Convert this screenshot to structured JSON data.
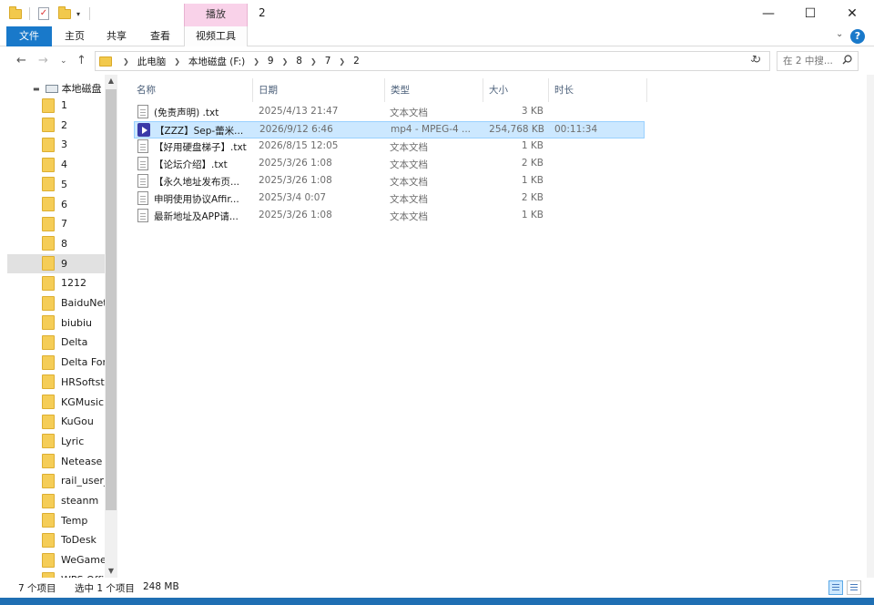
{
  "window": {
    "title": "2",
    "context_tab": "播放",
    "minimize": "—",
    "maximize": "☐",
    "close": "✕"
  },
  "ribbon": {
    "tabs": [
      "文件",
      "主页",
      "共享",
      "查看",
      "视频工具"
    ],
    "expand": "⌄",
    "help": "?"
  },
  "nav": {
    "back": "←",
    "forward": "→",
    "recent": "⌄",
    "up": "↑",
    "breadcrumb": [
      "此电脑",
      "本地磁盘 (F:)",
      "9",
      "8",
      "7",
      "2"
    ],
    "refresh": "↻",
    "search_placeholder": "在 2 中搜..."
  },
  "navpane": {
    "root": "本地磁盘 (F:)",
    "items": [
      "1",
      "2",
      "3",
      "4",
      "5",
      "6",
      "7",
      "8",
      "9",
      "1212",
      "BaiduNetdisk",
      "biubiu",
      "Delta",
      "Delta Force",
      "HRSoftstore",
      "KGMusic",
      "KuGou",
      "Lyric",
      "Netease",
      "rail_user_data",
      "steanm",
      "Temp",
      "ToDesk",
      "WeGameApps",
      "WPS Office"
    ],
    "selected_index": 8
  },
  "columns": [
    "名称",
    "日期",
    "类型",
    "大小",
    "时长"
  ],
  "files": [
    {
      "name": "(免责声明) .txt",
      "date": "2025/4/13 21:47",
      "type": "文本文档",
      "size": "3 KB",
      "duration": "",
      "icon": "text-file-icon",
      "selected": false
    },
    {
      "name": "【ZZZ】Sep-蕾米...",
      "date": "2026/9/12 6:46",
      "type": "mp4 - MPEG-4 ...",
      "size": "254,768 KB",
      "duration": "00:11:34",
      "icon": "video-file-icon",
      "selected": true
    },
    {
      "name": "【好用硬盘梯子】.txt",
      "date": "2026/8/15 12:05",
      "type": "文本文档",
      "size": "1 KB",
      "duration": "",
      "icon": "text-file-icon",
      "selected": false
    },
    {
      "name": "【论坛介绍】.txt",
      "date": "2025/3/26 1:08",
      "type": "文本文档",
      "size": "2 KB",
      "duration": "",
      "icon": "text-file-icon",
      "selected": false
    },
    {
      "name": "【永久地址发布页...",
      "date": "2025/3/26 1:08",
      "type": "文本文档",
      "size": "1 KB",
      "duration": "",
      "icon": "text-file-icon",
      "selected": false
    },
    {
      "name": "申明使用协议Affir...",
      "date": "2025/3/4 0:07",
      "type": "文本文档",
      "size": "2 KB",
      "duration": "",
      "icon": "text-file-icon",
      "selected": false
    },
    {
      "name": "最新地址及APP请...",
      "date": "2025/3/26 1:08",
      "type": "文本文档",
      "size": "1 KB",
      "duration": "",
      "icon": "text-file-icon",
      "selected": false
    }
  ],
  "status": {
    "count": "7 个项目",
    "selection": "选中 1 个项目",
    "size": "248 MB"
  }
}
